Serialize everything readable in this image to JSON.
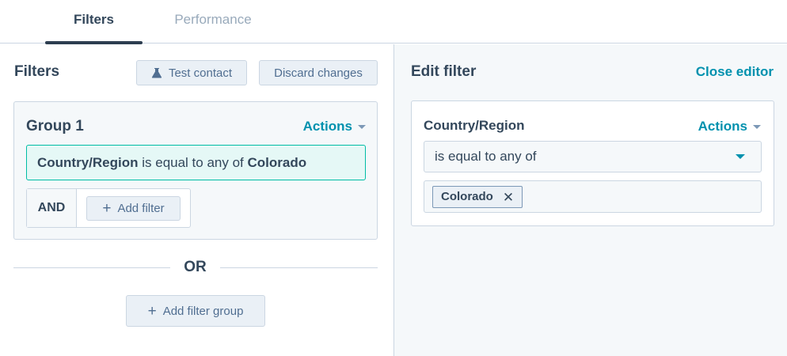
{
  "tabs": [
    {
      "label": "Filters",
      "active": true
    },
    {
      "label": "Performance",
      "active": false
    }
  ],
  "left": {
    "title": "Filters",
    "test_contact_label": "Test contact",
    "test_contact_icon": "flask-icon",
    "discard_label": "Discard changes",
    "group": {
      "title": "Group 1",
      "actions_label": "Actions",
      "filter": {
        "property": "Country/Region",
        "operator": "is equal to any of",
        "value": "Colorado"
      },
      "and_label": "AND",
      "add_filter_label": "Add filter"
    },
    "or_label": "OR",
    "add_group_label": "Add filter group"
  },
  "right": {
    "title": "Edit filter",
    "close_label": "Close editor",
    "property": "Country/Region",
    "actions_label": "Actions",
    "operator_selected": "is equal to any of",
    "values": [
      "Colorado"
    ]
  },
  "colors": {
    "accent": "#0091ae",
    "text": "#33475b",
    "selected_bg": "#e5f8f6",
    "selected_border": "#00bda5"
  }
}
